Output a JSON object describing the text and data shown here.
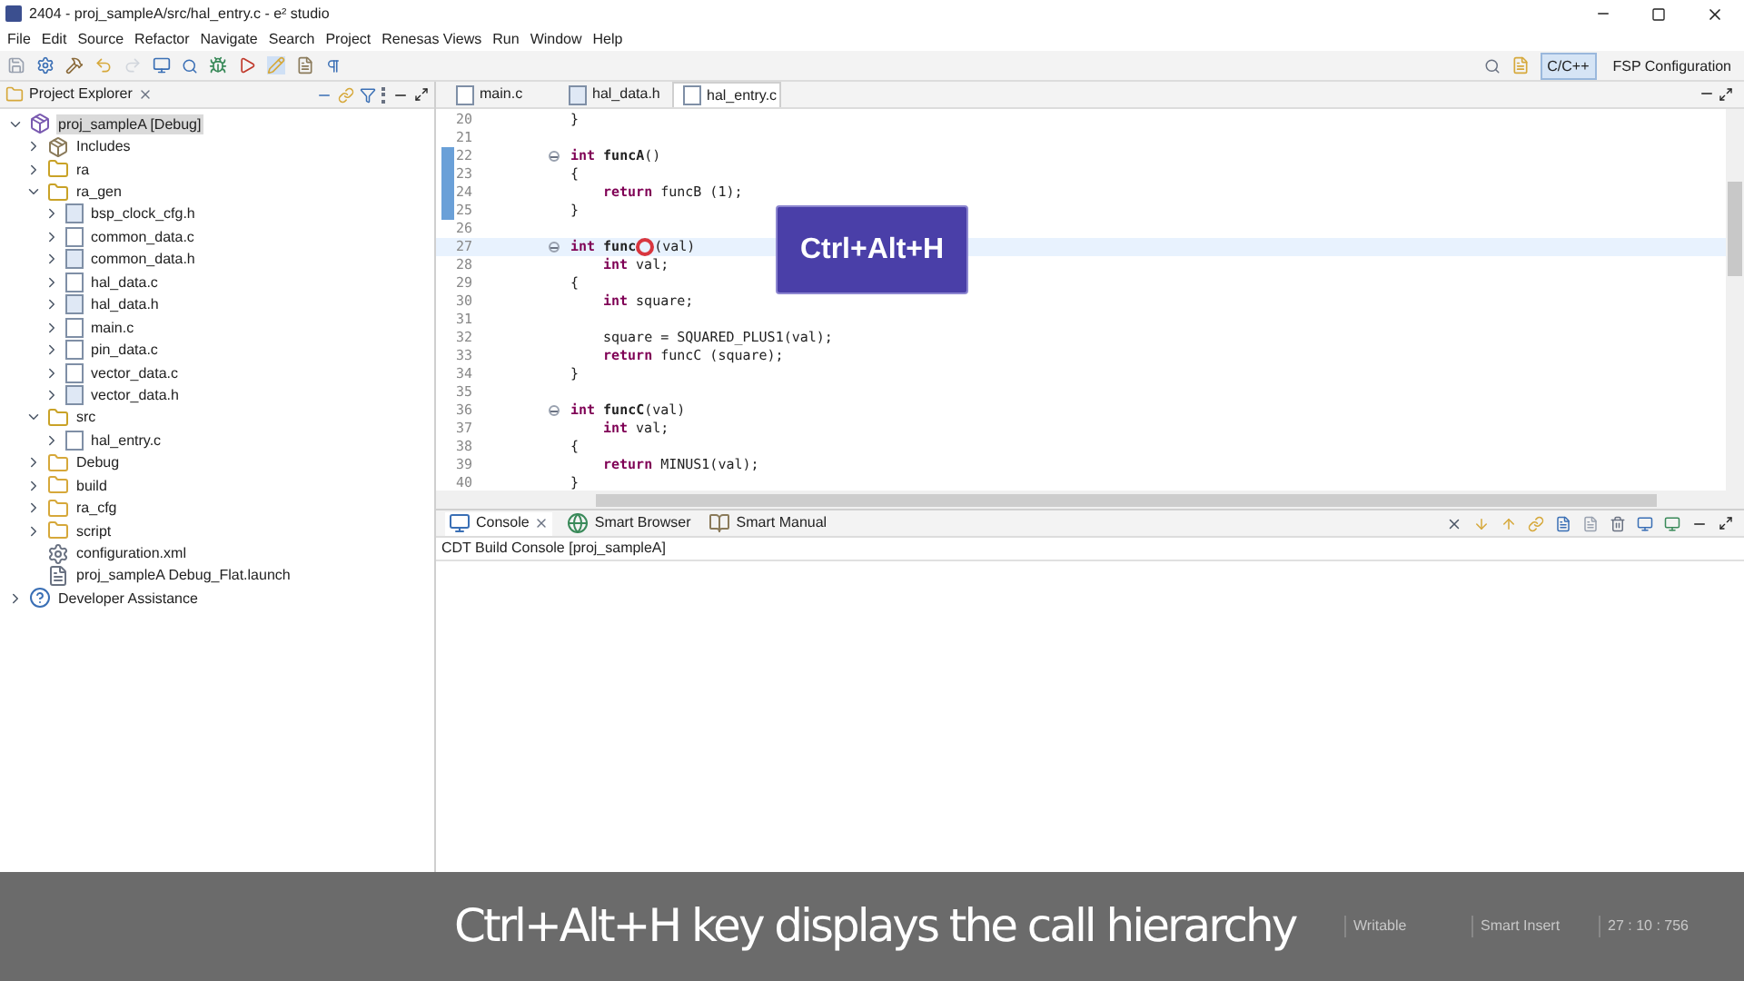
{
  "window": {
    "title": "2404 - proj_sampleA/src/hal_entry.c - e² studio"
  },
  "menu": [
    "File",
    "Edit",
    "Source",
    "Refactor",
    "Navigate",
    "Search",
    "Project",
    "Renesas Views",
    "Run",
    "Window",
    "Help"
  ],
  "perspectives": [
    {
      "label": "C/C++",
      "selected": true
    },
    {
      "label": "FSP Configuration",
      "selected": false
    }
  ],
  "project_explorer": {
    "title": "Project Explorer",
    "tree": [
      {
        "label": "proj_sampleA [Debug]",
        "kind": "project",
        "expanded": true,
        "selected": true,
        "children": [
          {
            "label": "Includes",
            "kind": "includes",
            "expanded": false,
            "selected": false
          },
          {
            "label": "ra",
            "kind": "srcfolder",
            "expanded": false,
            "selected": false
          },
          {
            "label": "ra_gen",
            "kind": "srcfolder",
            "expanded": true,
            "selected": false,
            "children": [
              {
                "label": "bsp_clock_cfg.h",
                "kind": "hfile",
                "expanded": false,
                "selected": false
              },
              {
                "label": "common_data.c",
                "kind": "cfile",
                "expanded": false,
                "selected": false
              },
              {
                "label": "common_data.h",
                "kind": "hfile",
                "expanded": false,
                "selected": false
              },
              {
                "label": "hal_data.c",
                "kind": "cfile",
                "expanded": false,
                "selected": false
              },
              {
                "label": "hal_data.h",
                "kind": "hfile",
                "expanded": false,
                "selected": false
              },
              {
                "label": "main.c",
                "kind": "cfile",
                "expanded": false,
                "selected": false
              },
              {
                "label": "pin_data.c",
                "kind": "cfile",
                "expanded": false,
                "selected": false
              },
              {
                "label": "vector_data.c",
                "kind": "cfile",
                "expanded": false,
                "selected": false
              },
              {
                "label": "vector_data.h",
                "kind": "hfile",
                "expanded": false,
                "selected": false
              }
            ]
          },
          {
            "label": "src",
            "kind": "srcfolder",
            "expanded": true,
            "selected": false,
            "children": [
              {
                "label": "hal_entry.c",
                "kind": "cfile",
                "expanded": false,
                "selected": false
              }
            ]
          },
          {
            "label": "Debug",
            "kind": "folder",
            "expanded": false,
            "selected": false
          },
          {
            "label": "build",
            "kind": "folder",
            "expanded": false,
            "selected": false
          },
          {
            "label": "ra_cfg",
            "kind": "folder",
            "expanded": false,
            "selected": false
          },
          {
            "label": "script",
            "kind": "folder",
            "expanded": false,
            "selected": false
          },
          {
            "label": "configuration.xml",
            "kind": "xml",
            "selected": false
          },
          {
            "label": "proj_sampleA Debug_Flat.launch",
            "kind": "launch",
            "selected": false
          }
        ]
      },
      {
        "label": "Developer Assistance",
        "kind": "help",
        "expanded": false,
        "selected": false
      }
    ]
  },
  "editor": {
    "tabs": [
      {
        "label": "main.c",
        "kind": "cfile",
        "selected": false
      },
      {
        "label": "hal_data.h",
        "kind": "hfile",
        "selected": false
      },
      {
        "label": "hal_entry.c",
        "kind": "cfile",
        "selected": true
      }
    ],
    "lines": [
      {
        "number": "20",
        "changed": false,
        "current": false,
        "fold": false,
        "indented": false,
        "tokens": [
          {
            "t": "}",
            "kind": "plain"
          }
        ]
      },
      {
        "number": "21",
        "changed": false,
        "current": false,
        "fold": false
      },
      {
        "number": "22",
        "changed": true,
        "current": false,
        "fold": true,
        "indented": false,
        "tokens": [
          {
            "t": "int",
            "kind": "keyword"
          },
          {
            "t": "funcA",
            "kind": "function"
          },
          {
            "t": "()",
            "kind": "plain"
          }
        ]
      },
      {
        "number": "23",
        "changed": true,
        "current": false,
        "fold": false,
        "indented": false,
        "tokens": [
          {
            "t": "{",
            "kind": "plain"
          }
        ]
      },
      {
        "number": "24",
        "changed": true,
        "current": false,
        "fold": false,
        "indented": true,
        "tokens": [
          {
            "t": "return",
            "kind": "keyword"
          },
          {
            "t": "funcB (1);",
            "kind": "plain"
          }
        ]
      },
      {
        "number": "25",
        "changed": true,
        "current": false,
        "fold": false,
        "indented": false,
        "tokens": [
          {
            "t": "}",
            "kind": "plain"
          }
        ]
      },
      {
        "number": "26",
        "changed": false,
        "current": false,
        "fold": false
      },
      {
        "number": "27",
        "changed": false,
        "current": true,
        "fold": true,
        "indented": false,
        "tokens": [
          {
            "t": "int",
            "kind": "keyword"
          },
          {
            "t": "func",
            "kind": "function"
          },
          {
            "kind": "cursor"
          },
          {
            "t": "(val)",
            "kind": "plain"
          }
        ]
      },
      {
        "number": "28",
        "changed": false,
        "current": false,
        "fold": false,
        "indented": true,
        "tokens": [
          {
            "t": "int",
            "kind": "keyword"
          },
          {
            "t": "val;",
            "kind": "plain"
          }
        ]
      },
      {
        "number": "29",
        "changed": false,
        "current": false,
        "fold": false,
        "indented": false,
        "tokens": [
          {
            "t": "{",
            "kind": "plain"
          }
        ]
      },
      {
        "number": "30",
        "changed": false,
        "current": false,
        "fold": false,
        "indented": true,
        "tokens": [
          {
            "t": "int",
            "kind": "keyword"
          },
          {
            "t": "square;",
            "kind": "plain"
          }
        ]
      },
      {
        "number": "31",
        "changed": false,
        "current": false,
        "fold": false
      },
      {
        "number": "32",
        "changed": false,
        "current": false,
        "fold": false,
        "indented": true,
        "tokens": [
          {
            "t": "square = SQUARED_PLUS1(val);",
            "kind": "plain"
          }
        ]
      },
      {
        "number": "33",
        "changed": false,
        "current": false,
        "fold": false,
        "indented": true,
        "tokens": [
          {
            "t": "return",
            "kind": "keyword"
          },
          {
            "t": "funcC (square);",
            "kind": "plain"
          }
        ]
      },
      {
        "number": "34",
        "changed": false,
        "current": false,
        "fold": false,
        "indented": false,
        "tokens": [
          {
            "t": "}",
            "kind": "plain"
          }
        ]
      },
      {
        "number": "35",
        "changed": false,
        "current": false,
        "fold": false
      },
      {
        "number": "36",
        "changed": false,
        "current": false,
        "fold": true,
        "indented": false,
        "tokens": [
          {
            "t": "int",
            "kind": "keyword"
          },
          {
            "t": "funcC",
            "kind": "function"
          },
          {
            "t": "(val)",
            "kind": "plain"
          }
        ]
      },
      {
        "number": "37",
        "changed": false,
        "current": false,
        "fold": false,
        "indented": true,
        "tokens": [
          {
            "t": "int",
            "kind": "keyword"
          },
          {
            "t": "val;",
            "kind": "plain"
          }
        ]
      },
      {
        "number": "38",
        "changed": false,
        "current": false,
        "fold": false,
        "indented": false,
        "tokens": [
          {
            "t": "{",
            "kind": "plain"
          }
        ]
      },
      {
        "number": "39",
        "changed": false,
        "current": false,
        "fold": false,
        "indented": true,
        "tokens": [
          {
            "t": "return",
            "kind": "keyword"
          },
          {
            "t": "MINUS1(val);",
            "kind": "plain"
          }
        ]
      },
      {
        "number": "40",
        "changed": false,
        "current": false,
        "fold": false,
        "indented": false,
        "tokens": [
          {
            "t": "}",
            "kind": "plain"
          }
        ]
      }
    ]
  },
  "shortcut_badge": "Ctrl+Alt+H",
  "console": {
    "tabs": [
      {
        "label": "Console",
        "kind": "console",
        "selected": true
      },
      {
        "label": "Smart Browser",
        "kind": "browser",
        "selected": false
      },
      {
        "label": "Smart Manual",
        "kind": "manual",
        "selected": false
      }
    ],
    "subtitle": "CDT Build Console [proj_sampleA]"
  },
  "status_bar": [
    "Writable",
    "Smart Insert",
    "27 : 10 : 756"
  ],
  "caption": "Ctrl+Alt+H key displays the call hierarchy"
}
